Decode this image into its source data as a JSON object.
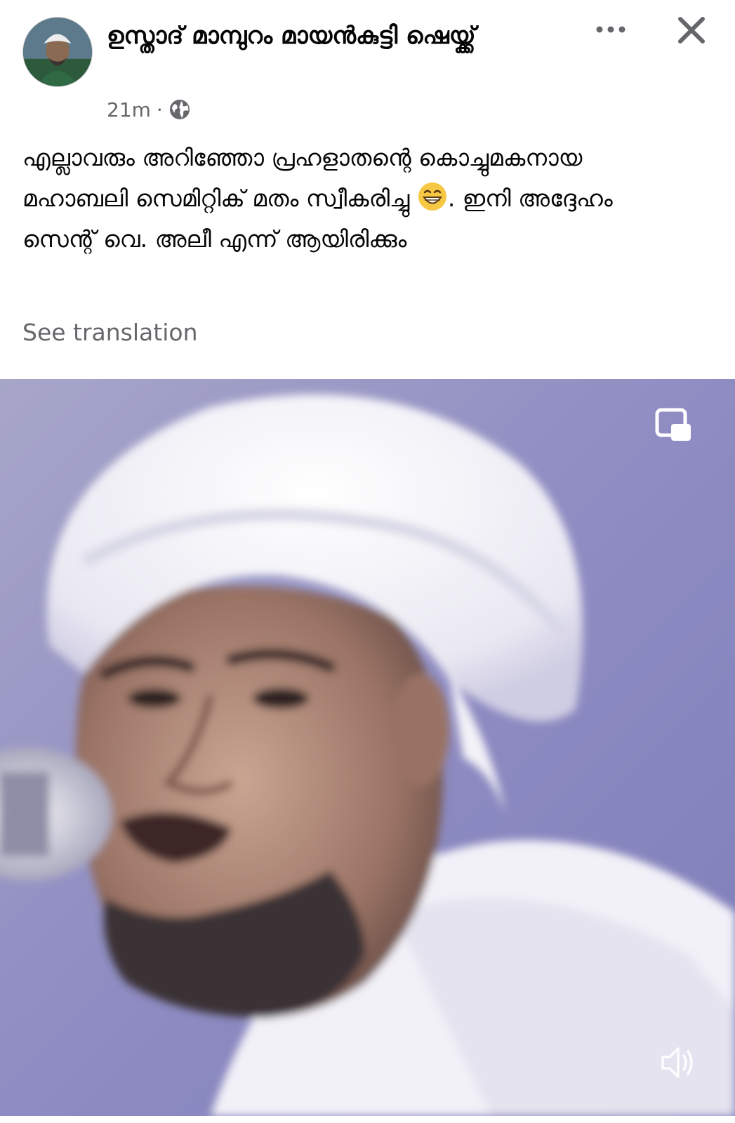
{
  "post": {
    "author_name": "ഉസ്താദ് മാമ്പുറം മായൻകുട്ടി ഷെയ്ക്ക്",
    "timestamp": "21m",
    "separator": "·",
    "audience_icon": "globe-icon",
    "more_icon": "more-horizontal-icon",
    "close_icon": "close-icon",
    "text_before_emoji": "എല്ലാവരും അറിഞ്ഞോ പ്രഹളാതന്റെ കൊച്ചുമകനായ മഹാബലി സെമിറ്റിക് മതം സ്വീകരിച്ചു ",
    "emoji": "😁",
    "text_after_emoji": ". ഇനി അദ്ദേഹം സെന്റ് വെ. അലീ എന്ന് ആയിരിക്കും",
    "see_translation": "See translation"
  },
  "video": {
    "pip_icon": "picture-in-picture-icon",
    "volume_icon": "volume-icon"
  },
  "colors": {
    "text_primary": "#050505",
    "text_secondary": "#65676b",
    "video_background": "#8c8cc0"
  }
}
